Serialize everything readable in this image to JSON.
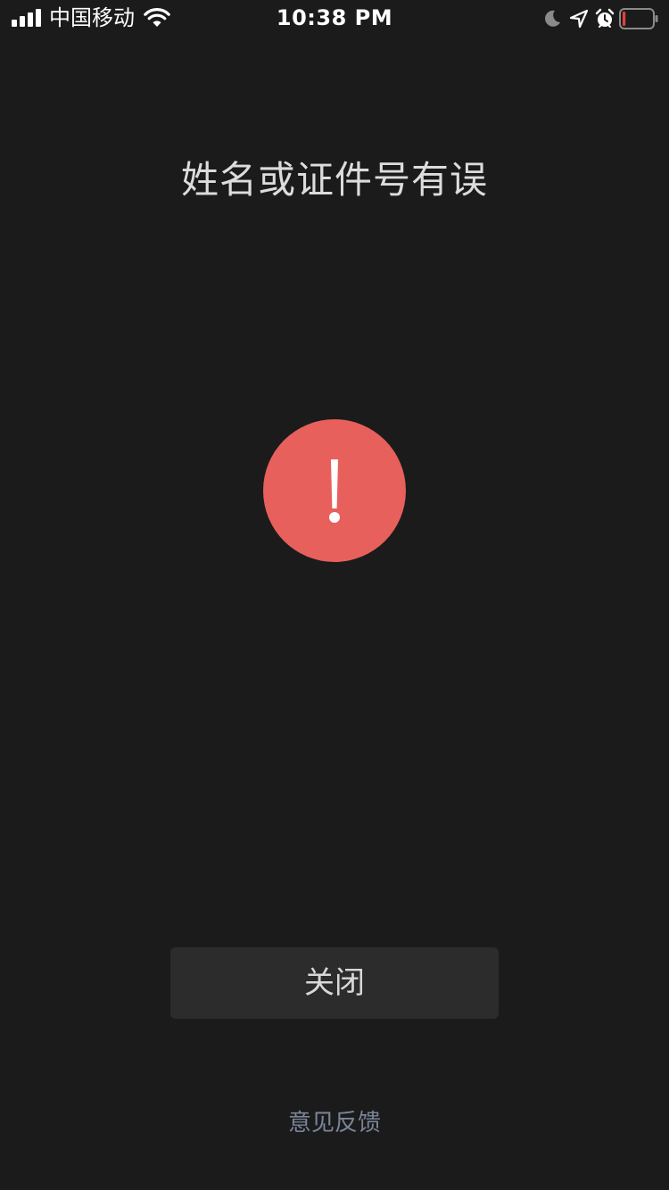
{
  "status_bar": {
    "carrier": "中国移动",
    "time": "10:38 PM",
    "icons": [
      "signal-icon",
      "wifi-icon",
      "moon-icon",
      "location-arrow-icon",
      "alarm-icon",
      "battery-icon"
    ],
    "battery_level": 0.1,
    "battery_color": "#e5413b"
  },
  "main": {
    "title": "姓名或证件号有误",
    "alert_icon": "exclamation-icon",
    "alert_color": "#e8605b",
    "close_button_label": "关闭",
    "feedback_link_label": "意见反馈",
    "feedback_link_color": "#7a8599"
  }
}
